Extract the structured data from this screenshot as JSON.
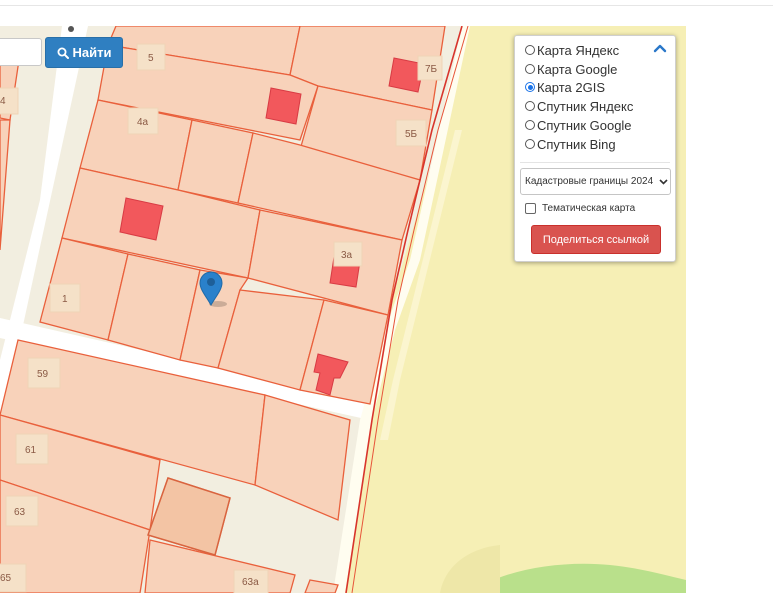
{
  "colors": {
    "map_background": "#f2eee0",
    "yellow_area": "#f6efb5",
    "parcel_fill": "#f8d2ba",
    "parcel_border": "#e9603c",
    "building_fill": "#f2585c",
    "road": "#ffffff",
    "marker": "#2a81cb",
    "search_button": "#2f7fc1",
    "share_button": "#d9534f",
    "green_area": "#b9e08b"
  },
  "search": {
    "button_label": "Найти",
    "input_value": "",
    "input_placeholder": "",
    "icon": "search-icon"
  },
  "map": {
    "parcel_labels": {
      "p5": "5",
      "p7b": "7Б",
      "p4": "4",
      "p4a": "4а",
      "p5b": "5Б",
      "p3a": "3а",
      "p1": "1",
      "p59": "59",
      "p61": "61",
      "p63": "63",
      "p63a": "63а",
      "p65": "65"
    },
    "marker_icon": "map-marker-icon"
  },
  "layers_panel": {
    "collapse_icon": "chevron-up-icon",
    "options": [
      {
        "label": "Карта Яндекс",
        "checked": false
      },
      {
        "label": "Карта Google",
        "checked": false
      },
      {
        "label": "Карта 2GIS",
        "checked": true
      },
      {
        "label": "Спутник Яндекс",
        "checked": false
      },
      {
        "label": "Спутник Google",
        "checked": false
      },
      {
        "label": "Спутник Bing",
        "checked": false
      }
    ],
    "layer_select_value": "Кадастровые границы 2024",
    "thematic_label": "Тематическая карта",
    "thematic_checked": false,
    "share_label": "Поделиться ссылкой"
  }
}
